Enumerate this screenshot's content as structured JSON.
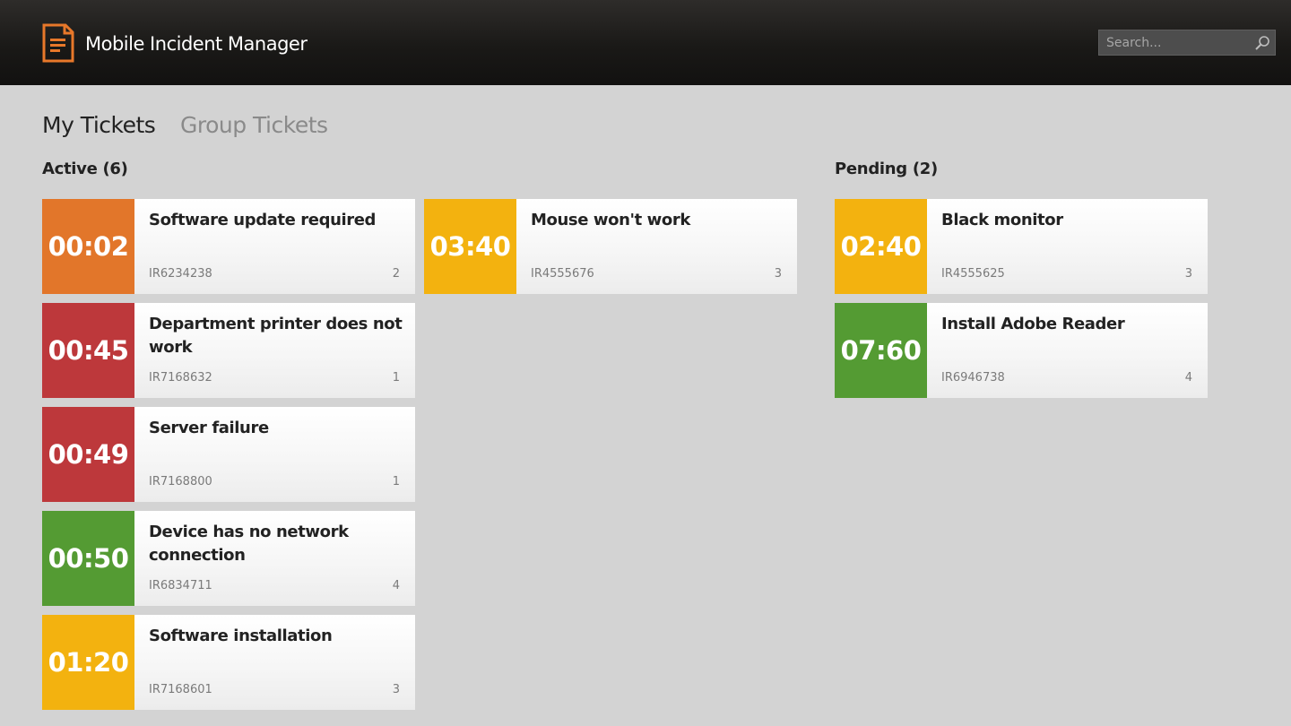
{
  "app": {
    "title": "Mobile Incident Manager",
    "logo_icon": "document-icon",
    "accent_color": "#e8782a"
  },
  "search": {
    "placeholder": "Search...",
    "value": "",
    "icon": "search-icon"
  },
  "tabs": [
    {
      "label": "My Tickets",
      "selected": true
    },
    {
      "label": "Group Tickets",
      "selected": false
    }
  ],
  "colors": {
    "orange": "#e2762a",
    "red": "#bd383b",
    "green": "#549b33",
    "yellow": "#f3b20f"
  },
  "sections": {
    "active": {
      "heading": "Active (6)",
      "tickets": [
        {
          "timer": "00:02",
          "title": "Software update required",
          "id": "IR6234238",
          "count": "2",
          "color": "#e2762a"
        },
        {
          "timer": "00:45",
          "title": "Department printer does not work",
          "id": "IR7168632",
          "count": "1",
          "color": "#bd383b"
        },
        {
          "timer": "00:49",
          "title": "Server failure",
          "id": "IR7168800",
          "count": "1",
          "color": "#bd383b"
        },
        {
          "timer": "00:50",
          "title": "Device has no network connection",
          "id": "IR6834711",
          "count": "4",
          "color": "#549b33"
        },
        {
          "timer": "01:20",
          "title": "Software installation",
          "id": "IR7168601",
          "count": "3",
          "color": "#f3b20f"
        },
        {
          "timer": "03:40",
          "title": "Mouse won't work",
          "id": "IR4555676",
          "count": "3",
          "color": "#f3b20f"
        }
      ]
    },
    "pending": {
      "heading": "Pending (2)",
      "tickets": [
        {
          "timer": "02:40",
          "title": "Black monitor",
          "id": "IR4555625",
          "count": "3",
          "color": "#f3b20f"
        },
        {
          "timer": "07:60",
          "title": "Install Adobe Reader",
          "id": "IR6946738",
          "count": "4",
          "color": "#549b33"
        }
      ]
    }
  }
}
